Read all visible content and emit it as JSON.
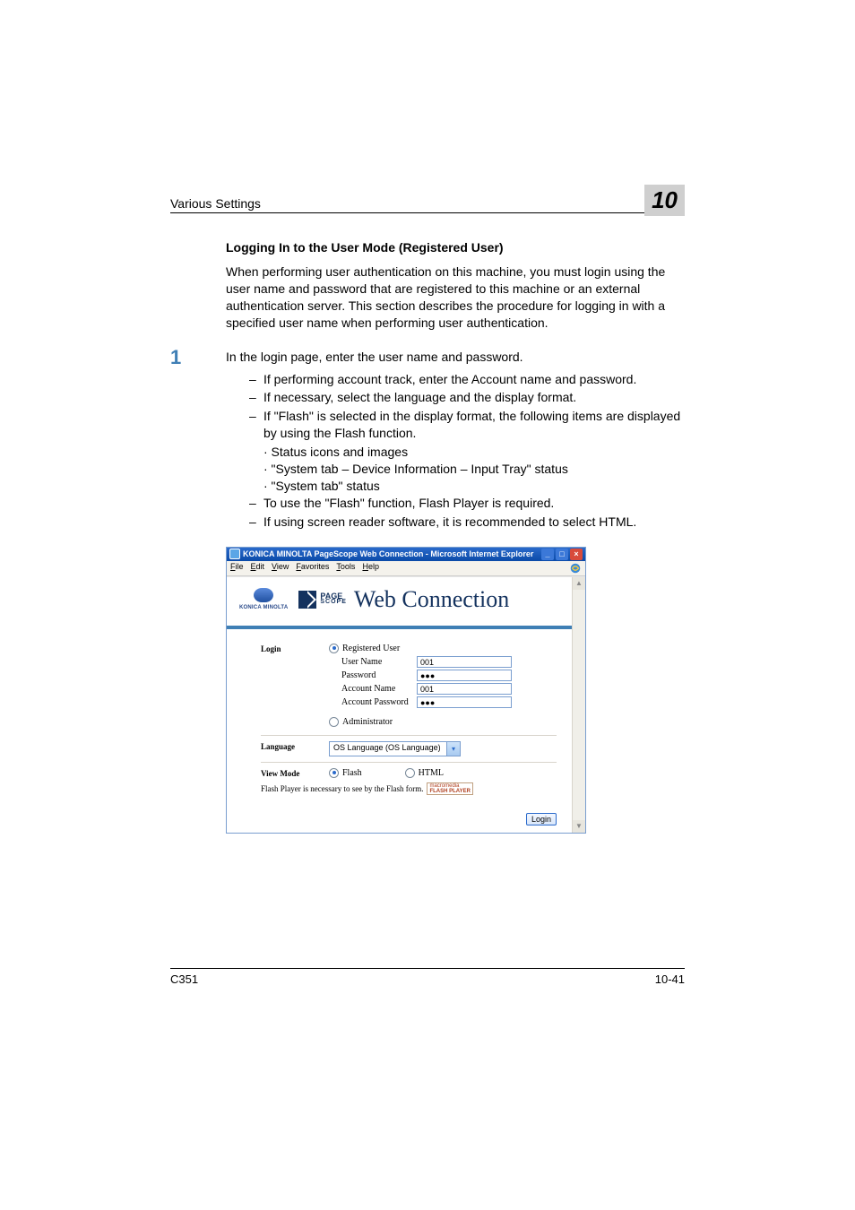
{
  "header": {
    "title": "Various Settings",
    "chapter": "10"
  },
  "section": {
    "heading": "Logging In to the User Mode (Registered User)",
    "intro": "When performing user authentication on this machine, you must login using the user name and password that are registered to this machine or an external authentication server. This section describes the procedure for logging in with a specified user name when performing user authentication."
  },
  "step1": {
    "num": "1",
    "text": "In the login page, enter the user name and password.",
    "dash1": "If performing account track, enter the Account name and password.",
    "dash2": "If necessary, select the language and the display format.",
    "dash3": "If \"Flash\" is selected in the display format, the following items are displayed by using the Flash function.",
    "dot1": "· Status icons and images",
    "dot2": "· \"System tab – Device Information – Input Tray\" status",
    "dot3": "· \"System tab\" status",
    "dash4": "To use the \"Flash\" function, Flash Player is required.",
    "dash5": "If using screen reader software, it is recommended to select HTML."
  },
  "screenshot": {
    "titlebar": "KONICA MINOLTA PageScope Web Connection - Microsoft Internet Explorer",
    "menus": {
      "file": "File",
      "edit": "Edit",
      "view": "View",
      "favorites": "Favorites",
      "tools": "Tools",
      "help": "Help"
    },
    "km_logo": "KONICA MINOLTA",
    "ps_top": "PAGE",
    "ps_bottom": "SCOPE",
    "wc_title": "Web Connection",
    "login": {
      "label": "Login",
      "registered_user": "Registered User",
      "user_name_label": "User Name",
      "user_name_value": "001",
      "password_label": "Password",
      "password_value": "●●●",
      "account_name_label": "Account Name",
      "account_name_value": "001",
      "account_password_label": "Account Password",
      "account_password_value": "●●●",
      "administrator": "Administrator"
    },
    "language": {
      "label": "Language",
      "value": "OS Language (OS Language)"
    },
    "viewmode": {
      "label": "View Mode",
      "flash": "Flash",
      "html": "HTML",
      "note": "Flash Player is necessary to see by the Flash form.",
      "badge_top": "macromedia",
      "badge_bottom": "FLASH PLAYER"
    },
    "login_button": "Login"
  },
  "footer": {
    "left": "C351",
    "right": "10-41"
  }
}
